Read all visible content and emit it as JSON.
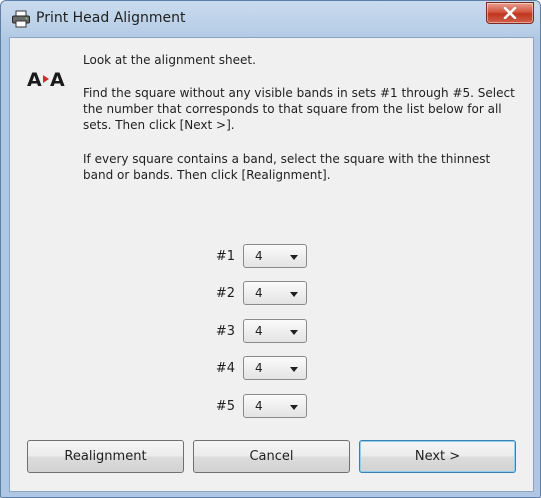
{
  "window": {
    "title": "Print Head Alignment"
  },
  "instructions": {
    "line1": "Look at the alignment sheet.",
    "line2": "Find the square without any visible bands in sets #1 through #5. Select the number that corresponds to that square from the list below for all sets. Then click [Next >].",
    "line3": "If every square contains a band, select the square with the thinnest band or bands. Then click [Realignment]."
  },
  "logo": {
    "left": "A",
    "right": "A"
  },
  "sets": [
    {
      "label": "#1",
      "value": "4"
    },
    {
      "label": "#2",
      "value": "4"
    },
    {
      "label": "#3",
      "value": "4"
    },
    {
      "label": "#4",
      "value": "4"
    },
    {
      "label": "#5",
      "value": "4"
    }
  ],
  "buttons": {
    "realignment": "Realignment",
    "cancel": "Cancel",
    "next": "Next >"
  },
  "icons": {
    "app": "printer-icon",
    "close": "close-icon",
    "logo": "alignment-icon"
  }
}
